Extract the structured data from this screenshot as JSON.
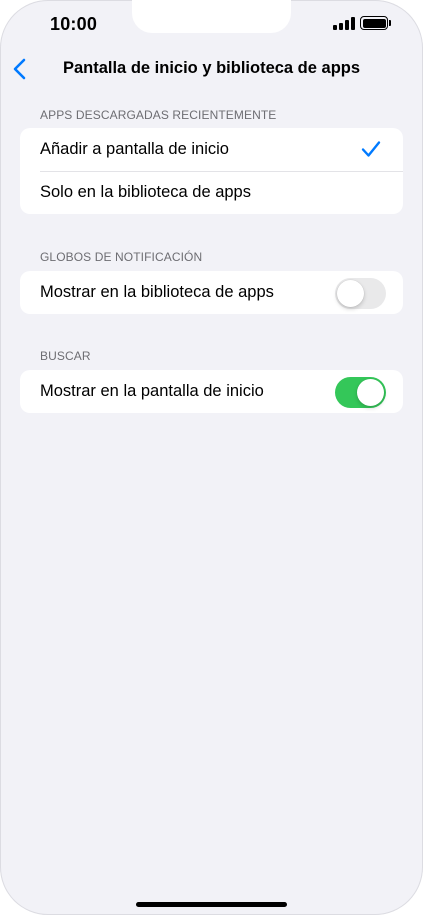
{
  "status_bar": {
    "time": "10:00"
  },
  "nav": {
    "back_icon": "chevron-left-icon",
    "title": "Pantalla de inicio y biblioteca de apps"
  },
  "sections": [
    {
      "header": "APPS DESCARGADAS RECIENTEMENTE",
      "rows": [
        {
          "label": "Añadir a pantalla de inicio",
          "selected": true
        },
        {
          "label": "Solo en la biblioteca de apps",
          "selected": false
        }
      ]
    },
    {
      "header": "GLOBOS DE NOTIFICACIÓN",
      "rows": [
        {
          "label": "Mostrar en la biblioteca de apps",
          "toggle": false
        }
      ]
    },
    {
      "header": "BUSCAR",
      "rows": [
        {
          "label": "Mostrar en la pantalla de inicio",
          "toggle": true
        }
      ]
    }
  ],
  "colors": {
    "accent": "#007aff",
    "toggle_on": "#34c759",
    "toggle_off": "#e9e9ea",
    "background": "#f2f2f7"
  }
}
